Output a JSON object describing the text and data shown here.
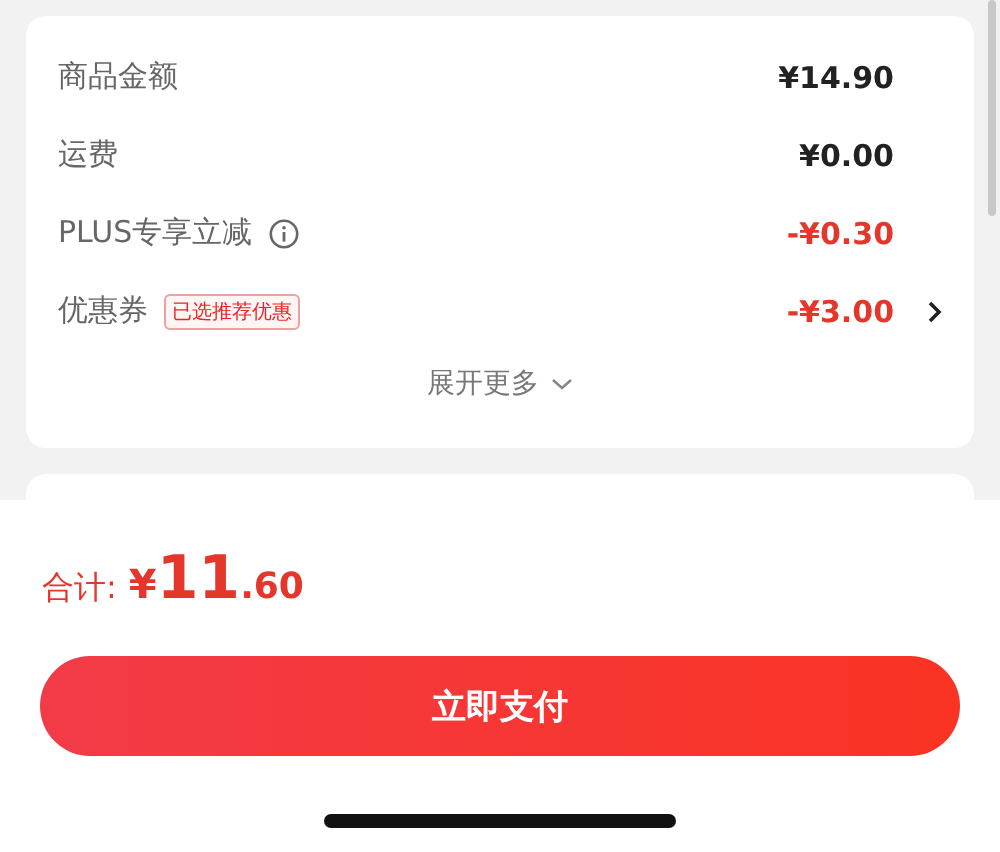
{
  "summary": {
    "rows": [
      {
        "label": "商品金额",
        "kind": "plain",
        "info": false,
        "tag": null,
        "value": "¥14.90",
        "chevron": false
      },
      {
        "label": "运费",
        "kind": "plain",
        "info": false,
        "tag": null,
        "value": "¥0.00",
        "chevron": false
      },
      {
        "label": "PLUS专享立减",
        "kind": "discount",
        "info": true,
        "tag": null,
        "value": "-¥0.30",
        "chevron": false
      },
      {
        "label": "优惠券",
        "kind": "discount",
        "info": false,
        "tag": "已选推荐优惠",
        "value": "-¥3.00",
        "chevron": true
      }
    ],
    "expand": "展开更多"
  },
  "total": {
    "label": "合计:",
    "currency": "¥",
    "integer": "11",
    "fraction": ".60"
  },
  "pay_button": "立即支付"
}
